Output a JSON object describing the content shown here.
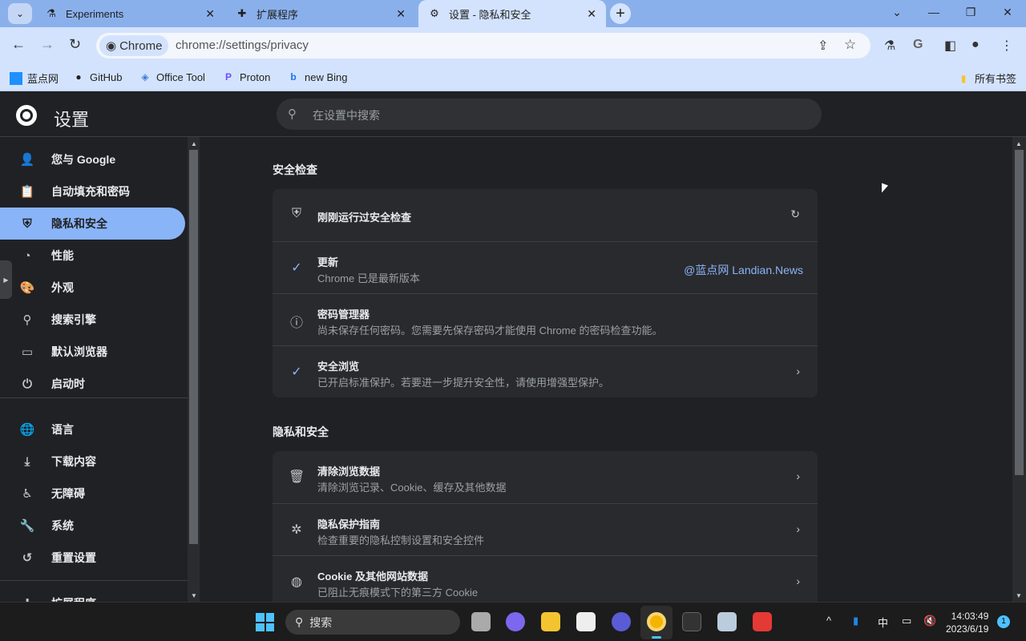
{
  "tabs": [
    {
      "label": "Experiments",
      "icon": "flask-icon"
    },
    {
      "label": "扩展程序",
      "icon": "puzzle-icon"
    },
    {
      "label": "设置 - 隐私和安全",
      "icon": "gear-icon",
      "active": true
    }
  ],
  "toolbar": {
    "chip": "Chrome",
    "url": "chrome://settings/privacy"
  },
  "bookmarks": [
    {
      "label": "蓝点网"
    },
    {
      "label": "GitHub"
    },
    {
      "label": "Office Tool"
    },
    {
      "label": "Proton"
    },
    {
      "label": "new Bing"
    }
  ],
  "all_bookmarks": "所有书签",
  "header": {
    "title": "设置",
    "search_placeholder": "在设置中搜索"
  },
  "sidebar": {
    "items": [
      {
        "label": "您与 Google",
        "icon": "person-icon"
      },
      {
        "label": "自动填充和密码",
        "icon": "clipboard-icon"
      },
      {
        "label": "隐私和安全",
        "icon": "shield-icon",
        "active": true
      },
      {
        "label": "性能",
        "icon": "speedometer-icon"
      },
      {
        "label": "外观",
        "icon": "palette-icon"
      },
      {
        "label": "搜索引擎",
        "icon": "search-icon"
      },
      {
        "label": "默认浏览器",
        "icon": "browser-icon"
      },
      {
        "label": "启动时",
        "icon": "power-icon"
      },
      {
        "label": "语言",
        "icon": "globe-icon"
      },
      {
        "label": "下载内容",
        "icon": "download-icon"
      },
      {
        "label": "无障碍",
        "icon": "accessibility-icon"
      },
      {
        "label": "系统",
        "icon": "wrench-icon"
      },
      {
        "label": "重置设置",
        "icon": "history-icon"
      },
      {
        "label": "扩展程序",
        "icon": "puzzle-icon"
      }
    ]
  },
  "safety": {
    "title": "安全检查",
    "rows": [
      {
        "title": "刚刚运行过安全检查",
        "icon": "shield-check-icon"
      },
      {
        "title": "更新",
        "sub": "Chrome 已是最新版本",
        "icon": "check-icon"
      },
      {
        "title": "密码管理器",
        "sub": "尚未保存任何密码。您需要先保存密码才能使用 Chrome 的密码检查功能。",
        "icon": "info-icon"
      },
      {
        "title": "安全浏览",
        "sub": "已开启标准保护。若要进一步提升安全性，请使用增强型保护。",
        "icon": "check-icon"
      }
    ]
  },
  "watermark": "@蓝点网 Landian.News",
  "privacy": {
    "title": "隐私和安全",
    "rows": [
      {
        "title": "清除浏览数据",
        "sub": "清除浏览记录、Cookie、缓存及其他数据",
        "icon": "trash-icon"
      },
      {
        "title": "隐私保护指南",
        "sub": "检查重要的隐私控制设置和安全控件",
        "icon": "compass-icon"
      },
      {
        "title": "Cookie 及其他网站数据",
        "sub": "已阻止无痕模式下的第三方 Cookie",
        "icon": "cookie-icon"
      }
    ]
  },
  "taskbar": {
    "search": "搜索",
    "ime": "中",
    "time": "14:03:49",
    "date": "2023/6/19",
    "notifications": "1"
  }
}
